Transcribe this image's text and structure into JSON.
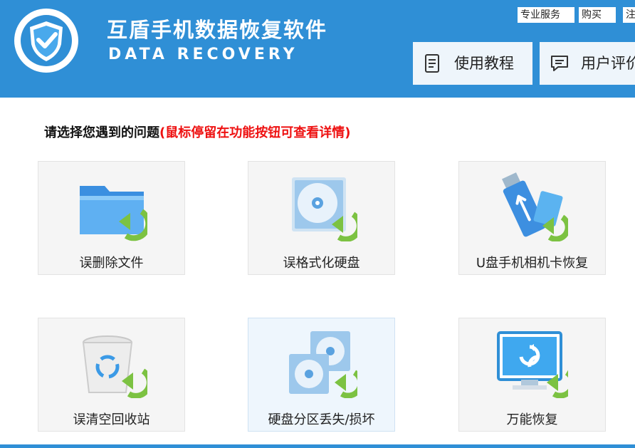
{
  "header": {
    "title": "互盾手机数据恢复软件",
    "subtitle": "DATA RECOVERY",
    "links": {
      "service": "专业服务",
      "buy": "购买",
      "register": "注"
    },
    "nav": {
      "tutorial": "使用教程",
      "review": "用户评价"
    }
  },
  "main": {
    "prompt": "请选择您遇到的问题",
    "prompt_hint": "(鼠标停留在功能按钮可查看详情)",
    "options": [
      {
        "label": "误删除文件",
        "icon": "folder-restore-icon"
      },
      {
        "label": "误格式化硬盘",
        "icon": "harddisk-restore-icon"
      },
      {
        "label": "U盘手机相机卡恢复",
        "icon": "usb-card-restore-icon"
      },
      {
        "label": "误清空回收站",
        "icon": "recycle-bin-restore-icon"
      },
      {
        "label": "硬盘分区丢失/损坏",
        "icon": "partition-restore-icon"
      },
      {
        "label": "万能恢复",
        "icon": "universal-restore-icon"
      }
    ]
  },
  "colors": {
    "header_bg": "#2f8fd6",
    "hint_red": "#ee1111",
    "card_bg": "#f5f5f5",
    "restore_arrow": "#7cc242"
  }
}
